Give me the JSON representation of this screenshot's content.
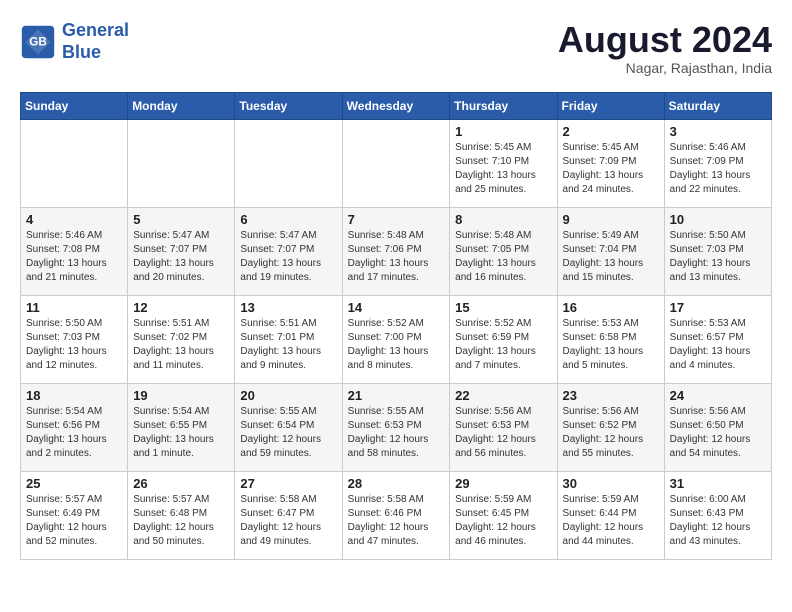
{
  "header": {
    "logo_line1": "General",
    "logo_line2": "Blue",
    "month_title": "August 2024",
    "location": "Nagar, Rajasthan, India"
  },
  "days_of_week": [
    "Sunday",
    "Monday",
    "Tuesday",
    "Wednesday",
    "Thursday",
    "Friday",
    "Saturday"
  ],
  "weeks": [
    [
      {
        "day": "",
        "info": ""
      },
      {
        "day": "",
        "info": ""
      },
      {
        "day": "",
        "info": ""
      },
      {
        "day": "",
        "info": ""
      },
      {
        "day": "1",
        "info": "Sunrise: 5:45 AM\nSunset: 7:10 PM\nDaylight: 13 hours\nand 25 minutes."
      },
      {
        "day": "2",
        "info": "Sunrise: 5:45 AM\nSunset: 7:09 PM\nDaylight: 13 hours\nand 24 minutes."
      },
      {
        "day": "3",
        "info": "Sunrise: 5:46 AM\nSunset: 7:09 PM\nDaylight: 13 hours\nand 22 minutes."
      }
    ],
    [
      {
        "day": "4",
        "info": "Sunrise: 5:46 AM\nSunset: 7:08 PM\nDaylight: 13 hours\nand 21 minutes."
      },
      {
        "day": "5",
        "info": "Sunrise: 5:47 AM\nSunset: 7:07 PM\nDaylight: 13 hours\nand 20 minutes."
      },
      {
        "day": "6",
        "info": "Sunrise: 5:47 AM\nSunset: 7:07 PM\nDaylight: 13 hours\nand 19 minutes."
      },
      {
        "day": "7",
        "info": "Sunrise: 5:48 AM\nSunset: 7:06 PM\nDaylight: 13 hours\nand 17 minutes."
      },
      {
        "day": "8",
        "info": "Sunrise: 5:48 AM\nSunset: 7:05 PM\nDaylight: 13 hours\nand 16 minutes."
      },
      {
        "day": "9",
        "info": "Sunrise: 5:49 AM\nSunset: 7:04 PM\nDaylight: 13 hours\nand 15 minutes."
      },
      {
        "day": "10",
        "info": "Sunrise: 5:50 AM\nSunset: 7:03 PM\nDaylight: 13 hours\nand 13 minutes."
      }
    ],
    [
      {
        "day": "11",
        "info": "Sunrise: 5:50 AM\nSunset: 7:03 PM\nDaylight: 13 hours\nand 12 minutes."
      },
      {
        "day": "12",
        "info": "Sunrise: 5:51 AM\nSunset: 7:02 PM\nDaylight: 13 hours\nand 11 minutes."
      },
      {
        "day": "13",
        "info": "Sunrise: 5:51 AM\nSunset: 7:01 PM\nDaylight: 13 hours\nand 9 minutes."
      },
      {
        "day": "14",
        "info": "Sunrise: 5:52 AM\nSunset: 7:00 PM\nDaylight: 13 hours\nand 8 minutes."
      },
      {
        "day": "15",
        "info": "Sunrise: 5:52 AM\nSunset: 6:59 PM\nDaylight: 13 hours\nand 7 minutes."
      },
      {
        "day": "16",
        "info": "Sunrise: 5:53 AM\nSunset: 6:58 PM\nDaylight: 13 hours\nand 5 minutes."
      },
      {
        "day": "17",
        "info": "Sunrise: 5:53 AM\nSunset: 6:57 PM\nDaylight: 13 hours\nand 4 minutes."
      }
    ],
    [
      {
        "day": "18",
        "info": "Sunrise: 5:54 AM\nSunset: 6:56 PM\nDaylight: 13 hours\nand 2 minutes."
      },
      {
        "day": "19",
        "info": "Sunrise: 5:54 AM\nSunset: 6:55 PM\nDaylight: 13 hours\nand 1 minute."
      },
      {
        "day": "20",
        "info": "Sunrise: 5:55 AM\nSunset: 6:54 PM\nDaylight: 12 hours\nand 59 minutes."
      },
      {
        "day": "21",
        "info": "Sunrise: 5:55 AM\nSunset: 6:53 PM\nDaylight: 12 hours\nand 58 minutes."
      },
      {
        "day": "22",
        "info": "Sunrise: 5:56 AM\nSunset: 6:53 PM\nDaylight: 12 hours\nand 56 minutes."
      },
      {
        "day": "23",
        "info": "Sunrise: 5:56 AM\nSunset: 6:52 PM\nDaylight: 12 hours\nand 55 minutes."
      },
      {
        "day": "24",
        "info": "Sunrise: 5:56 AM\nSunset: 6:50 PM\nDaylight: 12 hours\nand 54 minutes."
      }
    ],
    [
      {
        "day": "25",
        "info": "Sunrise: 5:57 AM\nSunset: 6:49 PM\nDaylight: 12 hours\nand 52 minutes."
      },
      {
        "day": "26",
        "info": "Sunrise: 5:57 AM\nSunset: 6:48 PM\nDaylight: 12 hours\nand 50 minutes."
      },
      {
        "day": "27",
        "info": "Sunrise: 5:58 AM\nSunset: 6:47 PM\nDaylight: 12 hours\nand 49 minutes."
      },
      {
        "day": "28",
        "info": "Sunrise: 5:58 AM\nSunset: 6:46 PM\nDaylight: 12 hours\nand 47 minutes."
      },
      {
        "day": "29",
        "info": "Sunrise: 5:59 AM\nSunset: 6:45 PM\nDaylight: 12 hours\nand 46 minutes."
      },
      {
        "day": "30",
        "info": "Sunrise: 5:59 AM\nSunset: 6:44 PM\nDaylight: 12 hours\nand 44 minutes."
      },
      {
        "day": "31",
        "info": "Sunrise: 6:00 AM\nSunset: 6:43 PM\nDaylight: 12 hours\nand 43 minutes."
      }
    ]
  ]
}
